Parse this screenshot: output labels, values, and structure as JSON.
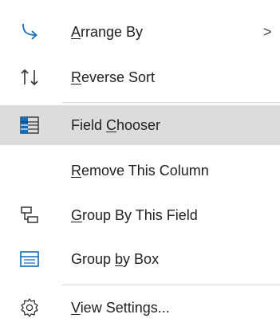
{
  "menu": {
    "items": [
      {
        "id": "arrange-by",
        "pre": "",
        "key": "A",
        "post": "rrange By",
        "icon": "arrange-arrow-icon",
        "submenu": true
      },
      {
        "id": "reverse-sort",
        "pre": "",
        "key": "R",
        "post": "everse Sort",
        "icon": "sort-arrows-icon"
      },
      {
        "id": "field-chooser",
        "pre": "Field ",
        "key": "C",
        "post": "hooser",
        "icon": "field-chooser-icon",
        "highlighted": true
      },
      {
        "id": "remove-column",
        "pre": "",
        "key": "R",
        "post": "emove This Column",
        "icon": ""
      },
      {
        "id": "group-by-field",
        "pre": "",
        "key": "G",
        "post": "roup By This Field",
        "icon": "group-field-icon"
      },
      {
        "id": "group-by-box",
        "pre": "Group ",
        "key": "b",
        "post": "y Box",
        "icon": "group-box-icon"
      },
      {
        "id": "view-settings",
        "pre": "",
        "key": "V",
        "post": "iew Settings...",
        "icon": "gear-icon"
      }
    ],
    "submenu_glyph": ">"
  },
  "colors": {
    "accent": "#0f6cbd",
    "highlight": "#dcdcdc"
  }
}
